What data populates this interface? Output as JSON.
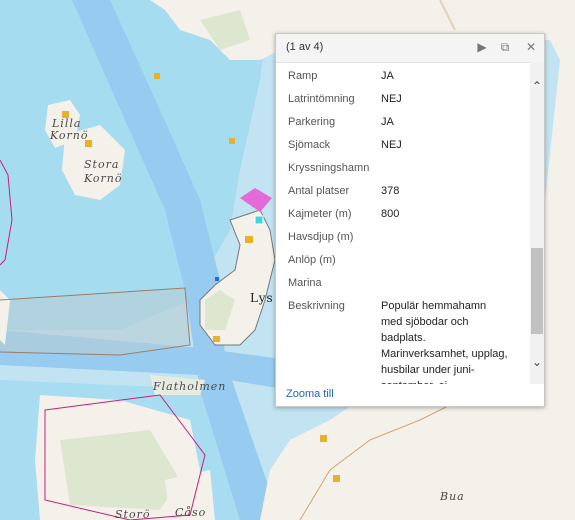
{
  "map": {
    "labels": {
      "lilla_1": "Lilla",
      "lilla_2": "Kornö",
      "stora_1": "Stora",
      "stora_2": "Kornö",
      "lysekil": "Lys",
      "flatholmen": "Flatholmen",
      "bua": "Bua",
      "storo": "Storö",
      "caso": "Cåso"
    },
    "colors": {
      "land": "#f4f1ea",
      "land_green": "#dde7cf",
      "water": "#c2e4f2",
      "shallow_water": "#a6dcf0",
      "channel": "#97cbf0",
      "zone_border": "#c81e7c",
      "marker": "#e8b12c"
    }
  },
  "popup": {
    "title": "(1 av 4)",
    "controls": {
      "next": "▶",
      "maximize": "⧉",
      "close": "✕"
    },
    "fields": [
      {
        "key": "Ramp",
        "value": "JA"
      },
      {
        "key": "Latrintömning",
        "value": "NEJ"
      },
      {
        "key": "Parkering",
        "value": "JA"
      },
      {
        "key": "Sjömack",
        "value": "NEJ"
      },
      {
        "key": "Kryssningshamn",
        "value": ""
      },
      {
        "key": "Antal platser",
        "value": "378"
      },
      {
        "key": "Kajmeter (m)",
        "value": "800"
      },
      {
        "key": "Havsdjup (m)",
        "value": ""
      },
      {
        "key": "Anlöp (m)",
        "value": ""
      },
      {
        "key": "Marina",
        "value": ""
      },
      {
        "key": "Beskrivning",
        "value": "Populär hemmahamn med sjöbodar och badplats. Marinverksamhet, upplag, husbilar under juni-september, ej"
      }
    ],
    "zoom_link": "Zooma till"
  }
}
